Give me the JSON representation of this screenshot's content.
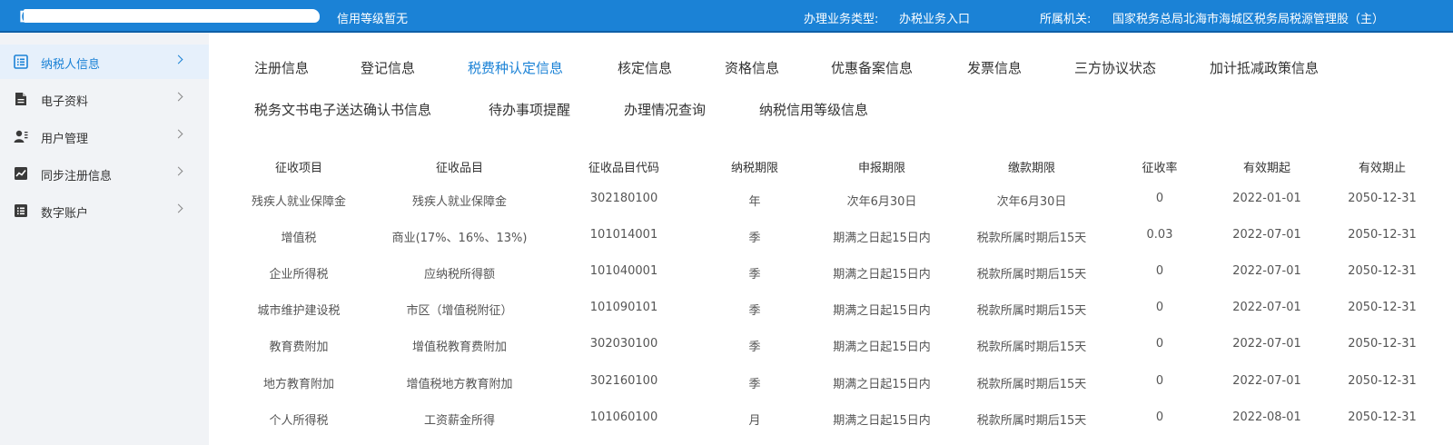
{
  "header": {
    "bracket": "【",
    "credit_level": "信用等级暂无",
    "biz_type_label": "办理业务类型:",
    "biz_type_value": "办税业务入口",
    "org_label": "所属机关:",
    "org_value": "国家税务总局北海市海城区税务局税源管理股（主）",
    "bar_color": "#1b82d6",
    "accent_color": "#1b82d6"
  },
  "sidebar": {
    "items": [
      {
        "label": "纳税人信息",
        "icon": "list-icon",
        "active": true
      },
      {
        "label": "电子资料",
        "icon": "document-icon",
        "active": false
      },
      {
        "label": "用户管理",
        "icon": "user-icon",
        "active": false
      },
      {
        "label": "同步注册信息",
        "icon": "chart-icon",
        "active": false
      },
      {
        "label": "数字账户",
        "icon": "list-icon",
        "active": false
      }
    ]
  },
  "tabs": [
    {
      "label": "注册信息",
      "active": false
    },
    {
      "label": "登记信息",
      "active": false
    },
    {
      "label": "税费种认定信息",
      "active": true
    },
    {
      "label": "核定信息",
      "active": false
    },
    {
      "label": "资格信息",
      "active": false
    },
    {
      "label": "优惠备案信息",
      "active": false
    },
    {
      "label": "发票信息",
      "active": false
    },
    {
      "label": "三方协议状态",
      "active": false
    },
    {
      "label": "加计抵减政策信息",
      "active": false
    },
    {
      "label": "税务文书电子送达确认书信息",
      "active": false
    },
    {
      "label": "待办事项提醒",
      "active": false
    },
    {
      "label": "办理情况查询",
      "active": false
    },
    {
      "label": "纳税信用等级信息",
      "active": false
    }
  ],
  "table": {
    "columns": [
      "征收项目",
      "征收品目",
      "征收品目代码",
      "纳税期限",
      "申报期限",
      "缴款期限",
      "征收率",
      "有效期起",
      "有效期止"
    ],
    "rows": [
      [
        "残疾人就业保障金",
        "残疾人就业保障金",
        "302180100",
        "年",
        "次年6月30日",
        "次年6月30日",
        "0",
        "2022-01-01",
        "2050-12-31"
      ],
      [
        "增值税",
        "商业(17%、16%、13%)",
        "101014001",
        "季",
        "期满之日起15日内",
        "税款所属时期后15天",
        "0.03",
        "2022-07-01",
        "2050-12-31"
      ],
      [
        "企业所得税",
        "应纳税所得额",
        "101040001",
        "季",
        "期满之日起15日内",
        "税款所属时期后15天",
        "0",
        "2022-07-01",
        "2050-12-31"
      ],
      [
        "城市维护建设税",
        "市区（增值税附征）",
        "101090101",
        "季",
        "期满之日起15日内",
        "税款所属时期后15天",
        "0",
        "2022-07-01",
        "2050-12-31"
      ],
      [
        "教育费附加",
        "增值税教育费附加",
        "302030100",
        "季",
        "期满之日起15日内",
        "税款所属时期后15天",
        "0",
        "2022-07-01",
        "2050-12-31"
      ],
      [
        "地方教育附加",
        "增值税地方教育附加",
        "302160100",
        "季",
        "期满之日起15日内",
        "税款所属时期后15天",
        "0",
        "2022-07-01",
        "2050-12-31"
      ],
      [
        "个人所得税",
        "工资薪金所得",
        "101060100",
        "月",
        "期满之日起15日内",
        "税款所属时期后15天",
        "0",
        "2022-08-01",
        "2050-12-31"
      ]
    ]
  }
}
